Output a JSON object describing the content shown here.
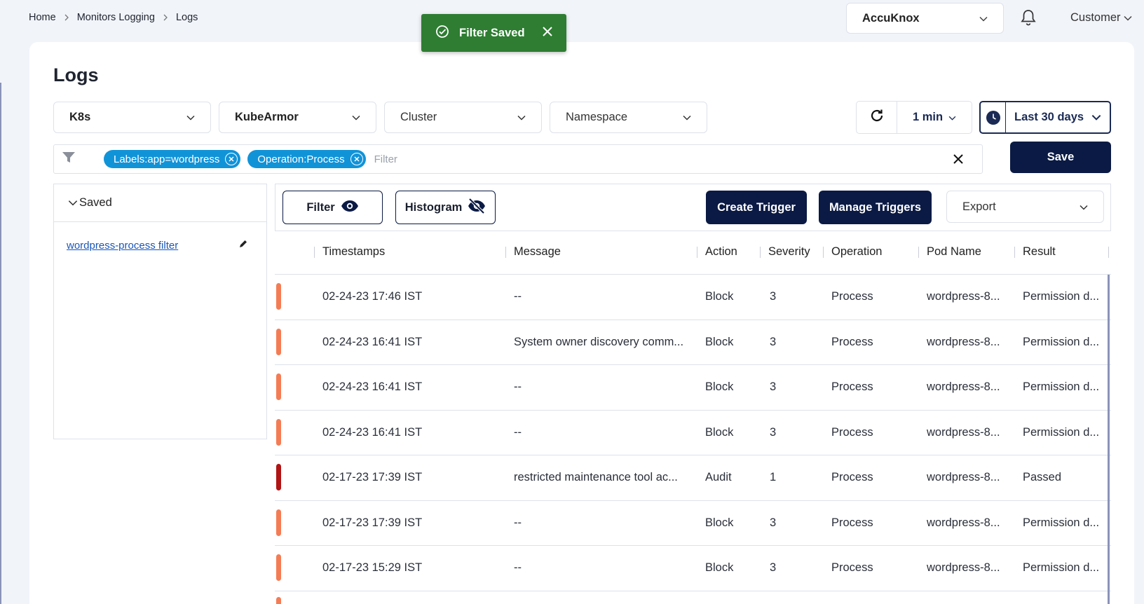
{
  "breadcrumb": [
    "Home",
    "Monitors Logging",
    "Logs"
  ],
  "toast": {
    "text": "Filter Saved",
    "color": "#2e7d32"
  },
  "tenant": "AccuKnox",
  "user_menu": "Customer",
  "page_title": "Logs",
  "dropdowns": {
    "type": "K8s",
    "source": "KubeArmor",
    "cluster": "Cluster",
    "namespace": "Namespace"
  },
  "refresh_interval": "1 min",
  "time_range": "Last 30 days",
  "filter": {
    "chips": [
      "Labels:app=wordpress",
      "Operation:Process"
    ],
    "placeholder": "Filter",
    "save_label": "Save"
  },
  "saved": {
    "title": "Saved",
    "items": [
      "wordpress-process filter"
    ]
  },
  "toolbar": {
    "filter_label": "Filter",
    "histogram_label": "Histogram",
    "create_trigger": "Create Trigger",
    "manage_triggers": "Manage Triggers",
    "export": "Export"
  },
  "table": {
    "columns": [
      "Timestamps",
      "Message",
      "Action",
      "Severity",
      "Operation",
      "Pod Name",
      "Result"
    ],
    "rows": [
      {
        "timestamp": "02-24-23 17:46 IST",
        "message": "--",
        "action": "Block",
        "severity": "3",
        "operation": "Process",
        "pod": "wordpress-8...",
        "result": "Permission d..."
      },
      {
        "timestamp": "02-24-23 16:41 IST",
        "message": "System owner discovery comm...",
        "action": "Block",
        "severity": "3",
        "operation": "Process",
        "pod": "wordpress-8...",
        "result": "Permission d..."
      },
      {
        "timestamp": "02-24-23 16:41 IST",
        "message": "--",
        "action": "Block",
        "severity": "3",
        "operation": "Process",
        "pod": "wordpress-8...",
        "result": "Permission d..."
      },
      {
        "timestamp": "02-24-23 16:41 IST",
        "message": "--",
        "action": "Block",
        "severity": "3",
        "operation": "Process",
        "pod": "wordpress-8...",
        "result": "Permission d..."
      },
      {
        "timestamp": "02-17-23 17:39 IST",
        "message": "restricted maintenance tool ac...",
        "action": "Audit",
        "severity": "1",
        "operation": "Process",
        "pod": "wordpress-8...",
        "result": "Passed"
      },
      {
        "timestamp": "02-17-23 17:39 IST",
        "message": "--",
        "action": "Block",
        "severity": "3",
        "operation": "Process",
        "pod": "wordpress-8...",
        "result": "Permission d..."
      },
      {
        "timestamp": "02-17-23 15:29 IST",
        "message": "--",
        "action": "Block",
        "severity": "3",
        "operation": "Process",
        "pod": "wordpress-8...",
        "result": "Permission d..."
      }
    ]
  },
  "severity_colors": {
    "3": "#f47c55",
    "1": "#b01414"
  },
  "colors": {
    "accent_dark": "#0b1a44",
    "chip": "#1193d8",
    "link": "#1a56b8"
  }
}
